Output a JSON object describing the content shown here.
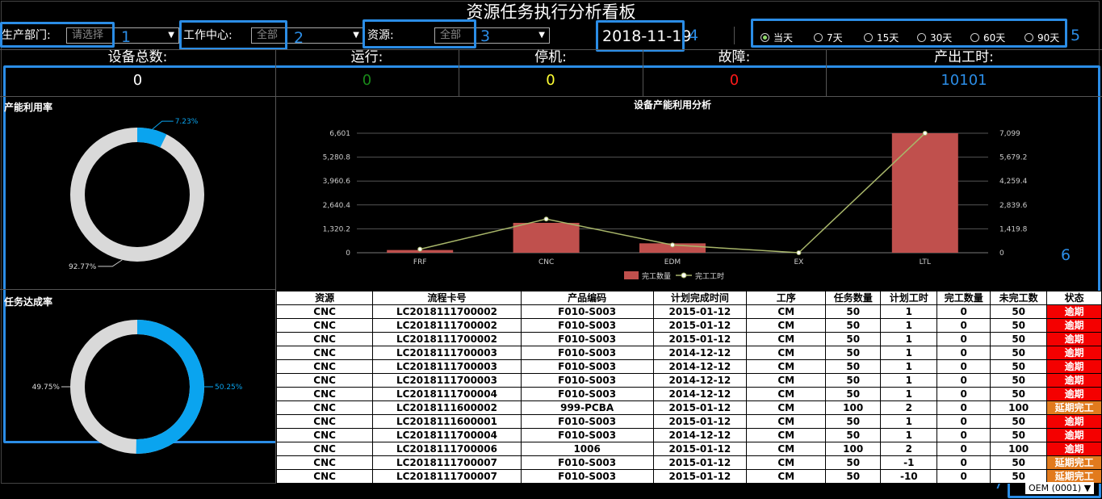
{
  "title": "资源任务执行分析看板",
  "filters": {
    "dept_label": "生产部门:",
    "dept_value": "请选择",
    "wc_label": "工作中心:",
    "wc_value": "全部",
    "res_label": "资源:",
    "res_value": "全部",
    "date": "2018-11-19"
  },
  "periods": [
    {
      "label": "当天",
      "selected": true
    },
    {
      "label": "7天",
      "selected": false
    },
    {
      "label": "15天",
      "selected": false
    },
    {
      "label": "30天",
      "selected": false
    },
    {
      "label": "60天",
      "selected": false
    },
    {
      "label": "90天",
      "selected": false
    }
  ],
  "annotations": [
    "1",
    "2",
    "3",
    "4",
    "5",
    "6",
    "7"
  ],
  "stats": [
    {
      "label": "设备总数:",
      "value": "0",
      "color": "#ffffff"
    },
    {
      "label": "运行:",
      "value": "0",
      "color": "#1a8a1a"
    },
    {
      "label": "停机:",
      "value": "0",
      "color": "#ffff33"
    },
    {
      "label": "故障:",
      "value": "0",
      "color": "#ff1a1a"
    },
    {
      "label": "产出工时:",
      "value": "10101",
      "color": "#2b8de6"
    }
  ],
  "utilization": {
    "title": "产能利用率",
    "blue_label": "7.23%",
    "gray_label": "92.77%",
    "blue_value": 7.23
  },
  "completion": {
    "title": "任务达成率",
    "blue_label": "50.25%",
    "gray_label": "49.75%",
    "blue_value": 50.25
  },
  "colors": {
    "accent": "#2b8de6",
    "donut_blue": "#0aa4ef",
    "donut_gray": "#d9d9d9",
    "bar": "#c0504d",
    "line": "#a8b66a"
  },
  "chart_data": {
    "type": "bar",
    "title": "设备产能利用分析",
    "categories": [
      "FRF",
      "CNC",
      "EDM",
      "EX",
      "LTL"
    ],
    "series": [
      {
        "name": "完工数量",
        "type": "bar",
        "values": [
          150,
          1650,
          520,
          0,
          6601
        ]
      },
      {
        "name": "完工工时",
        "type": "line",
        "values": [
          210,
          2000,
          460,
          0,
          7099
        ]
      }
    ],
    "y_left_ticks": [
      "0",
      "1,320.2",
      "2,640.4",
      "3,960.6",
      "5,280.8",
      "6,601"
    ],
    "y_right_ticks": [
      "0",
      "1,419.8",
      "2,839.6",
      "4,259.4",
      "5,679.2",
      "7,099"
    ],
    "y_left_max": 6601,
    "y_right_max": 7099,
    "legend": "bottom"
  },
  "table": {
    "headers": [
      "资源",
      "流程卡号",
      "产品编码",
      "计划完成时间",
      "工序",
      "任务数量",
      "计划工时",
      "完工数量",
      "未完工数",
      "状态"
    ],
    "rows": [
      [
        "CNC",
        "LC2018111700002",
        "F010-S003",
        "2015-01-12",
        "CM",
        "50",
        "1",
        "0",
        "50",
        "逾期"
      ],
      [
        "CNC",
        "LC2018111700002",
        "F010-S003",
        "2015-01-12",
        "CM",
        "50",
        "1",
        "0",
        "50",
        "逾期"
      ],
      [
        "CNC",
        "LC2018111700002",
        "F010-S003",
        "2015-01-12",
        "CM",
        "50",
        "1",
        "0",
        "50",
        "逾期"
      ],
      [
        "CNC",
        "LC2018111700003",
        "F010-S003",
        "2014-12-12",
        "CM",
        "50",
        "1",
        "0",
        "50",
        "逾期"
      ],
      [
        "CNC",
        "LC2018111700003",
        "F010-S003",
        "2014-12-12",
        "CM",
        "50",
        "1",
        "0",
        "50",
        "逾期"
      ],
      [
        "CNC",
        "LC2018111700003",
        "F010-S003",
        "2014-12-12",
        "CM",
        "50",
        "1",
        "0",
        "50",
        "逾期"
      ],
      [
        "CNC",
        "LC2018111700004",
        "F010-S003",
        "2014-12-12",
        "CM",
        "50",
        "1",
        "0",
        "50",
        "逾期"
      ],
      [
        "CNC",
        "LC2018111600002",
        "999-PCBA",
        "2015-01-12",
        "CM",
        "100",
        "2",
        "0",
        "100",
        "延期完工"
      ],
      [
        "CNC",
        "LC2018111600001",
        "F010-S003",
        "2015-01-12",
        "CM",
        "50",
        "1",
        "0",
        "50",
        "逾期"
      ],
      [
        "CNC",
        "LC2018111700004",
        "F010-S003",
        "2014-12-12",
        "CM",
        "50",
        "1",
        "0",
        "50",
        "逾期"
      ],
      [
        "CNC",
        "LC2018111700006",
        "1006",
        "2015-01-12",
        "CM",
        "100",
        "2",
        "0",
        "100",
        "逾期"
      ],
      [
        "CNC",
        "LC2018111700007",
        "F010-S003",
        "2015-01-12",
        "CM",
        "50",
        "-1",
        "0",
        "50",
        "延期完工"
      ],
      [
        "CNC",
        "LC2018111700007",
        "F010-S003",
        "2015-01-12",
        "CM",
        "50",
        "-10",
        "0",
        "50",
        "延期完工"
      ]
    ]
  },
  "org_select": "OEM (0001)"
}
